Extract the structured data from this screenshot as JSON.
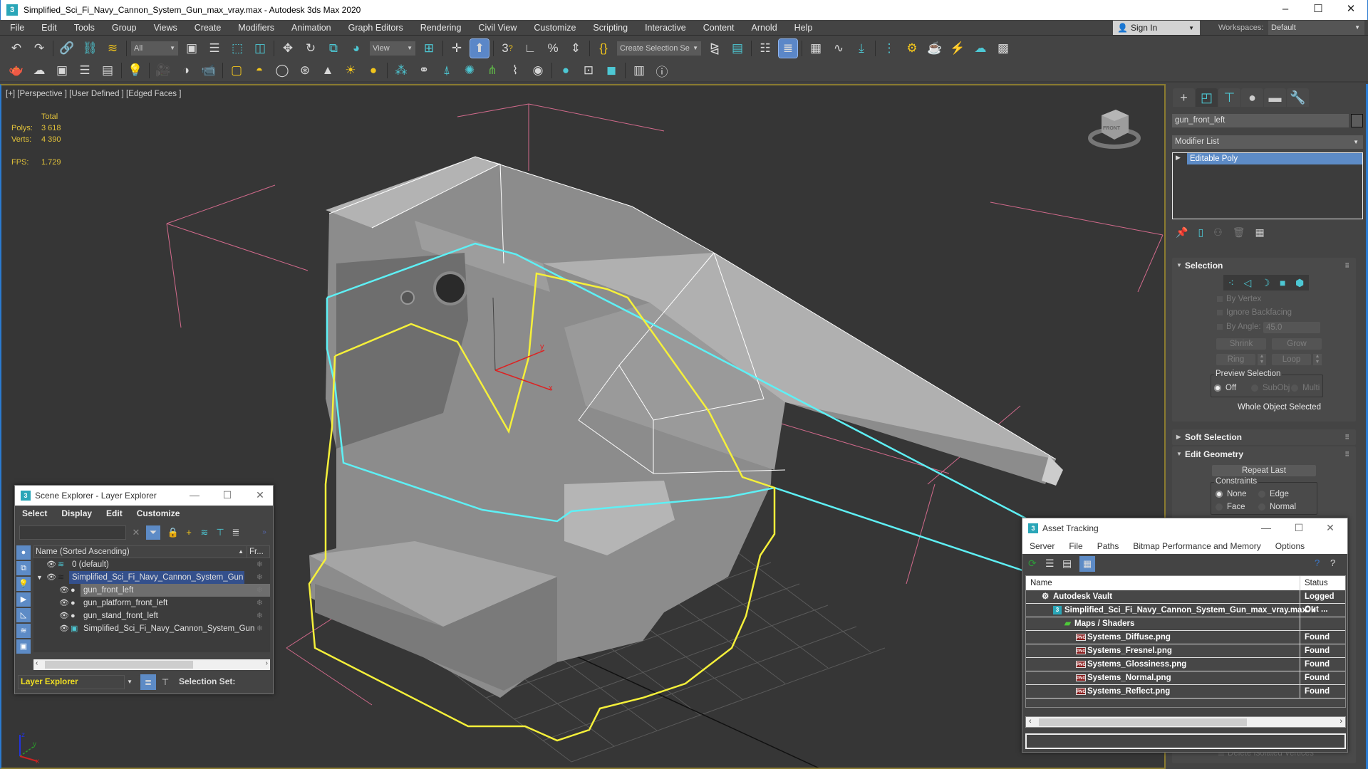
{
  "window": {
    "title": "Simplified_Sci_Fi_Navy_Cannon_System_Gun_max_vray.max - Autodesk 3ds Max 2020",
    "app_icon": "3",
    "minimize": "–",
    "maximize": "☐",
    "close": "✕"
  },
  "menubar": {
    "items": [
      "File",
      "Edit",
      "Tools",
      "Group",
      "Views",
      "Create",
      "Modifiers",
      "Animation",
      "Graph Editors",
      "Rendering",
      "Civil View",
      "Customize",
      "Scripting",
      "Interactive",
      "Content",
      "Arnold",
      "Help"
    ],
    "sign_in": "Sign In",
    "workspaces_label": "Workspaces:",
    "workspace_value": "Default"
  },
  "toolbar": {
    "selection_filter": "All",
    "reference_coord": "View",
    "named_selection_placeholder": "Create Selection Se",
    "snap_label": "3"
  },
  "viewport": {
    "label": "[+] [Perspective ] [User Defined ] [Edged Faces ]",
    "stats": {
      "header": "Total",
      "polys_label": "Polys:",
      "polys_value": "3 618",
      "verts_label": "Verts:",
      "verts_value": "4 390",
      "fps_label": "FPS:",
      "fps_value": "1.729"
    },
    "viewcube_face": "FRONT",
    "axis_labels": {
      "x": "x",
      "y": "y",
      "z": "z"
    }
  },
  "command_panel": {
    "object_name": "gun_front_left",
    "modifier_list": "Modifier List",
    "stack": [
      "Editable Poly"
    ],
    "selection": {
      "title": "Selection",
      "by_vertex": "By Vertex",
      "ignore_backfacing": "Ignore Backfacing",
      "by_angle": "By Angle:",
      "angle_value": "45.0",
      "shrink": "Shrink",
      "grow": "Grow",
      "ring": "Ring",
      "loop": "Loop",
      "preview_selection": "Preview Selection",
      "preview_options": [
        "Off",
        "SubObj",
        "Multi"
      ],
      "preview_selected": "Off",
      "status": "Whole Object Selected"
    },
    "soft_selection": {
      "title": "Soft Selection"
    },
    "edit_geometry": {
      "title": "Edit Geometry",
      "repeat_last": "Repeat Last",
      "constraints_label": "Constraints",
      "constraints": [
        "None",
        "Edge",
        "Face",
        "Normal"
      ],
      "constraint_selected": "None",
      "hidden_item": "Delete Isolated Vertices"
    }
  },
  "scene_explorer": {
    "title": "Scene Explorer - Layer Explorer",
    "menu": [
      "Select",
      "Display",
      "Edit",
      "Customize"
    ],
    "search_value": "",
    "column_name": "Name (Sorted Ascending)",
    "column_frozen": "Fr...",
    "rows": [
      {
        "name": "0 (default)",
        "type": "layer",
        "level": 0
      },
      {
        "name": "Simplified_Sci_Fi_Navy_Cannon_System_Gun",
        "type": "layer",
        "level": 0,
        "expanded": true,
        "selected": true
      },
      {
        "name": "gun_front_left",
        "type": "object",
        "level": 1,
        "highlighted": true
      },
      {
        "name": "gun_platform_front_left",
        "type": "object",
        "level": 1
      },
      {
        "name": "gun_stand_front_left",
        "type": "object",
        "level": 1
      },
      {
        "name": "Simplified_Sci_Fi_Navy_Cannon_System_Gun",
        "type": "group",
        "level": 1
      }
    ],
    "explorer_mode": "Layer Explorer",
    "selection_set_label": "Selection Set:"
  },
  "asset_tracking": {
    "title": "Asset Tracking",
    "menu": [
      "Server",
      "File",
      "Paths",
      "Bitmap Performance and Memory",
      "Options"
    ],
    "columns": [
      "Name",
      "Status"
    ],
    "rows": [
      {
        "name": "Autodesk Vault",
        "status": "Logged Out ...",
        "level": 0,
        "icon": "vault"
      },
      {
        "name": "Simplified_Sci_Fi_Navy_Cannon_System_Gun_max_vray.max",
        "status": "Ok",
        "level": 1,
        "icon": "max"
      },
      {
        "name": "Maps / Shaders",
        "status": "",
        "level": 2,
        "icon": "maps"
      },
      {
        "name": "Systems_Diffuse.png",
        "status": "Found",
        "level": 3,
        "icon": "png"
      },
      {
        "name": "Systems_Fresnel.png",
        "status": "Found",
        "level": 3,
        "icon": "png"
      },
      {
        "name": "Systems_Glossiness.png",
        "status": "Found",
        "level": 3,
        "icon": "png"
      },
      {
        "name": "Systems_Normal.png",
        "status": "Found",
        "level": 3,
        "icon": "png"
      },
      {
        "name": "Systems_Reflect.png",
        "status": "Found",
        "level": 3,
        "icon": "png"
      }
    ]
  },
  "colors": {
    "accent_blue": "#5d8bc6",
    "teal_icon": "#4dc8d4",
    "selection_yellow": "#f5f03a",
    "selection_cyan": "#5ef0f5",
    "stats_yellow": "#e3c33a"
  }
}
